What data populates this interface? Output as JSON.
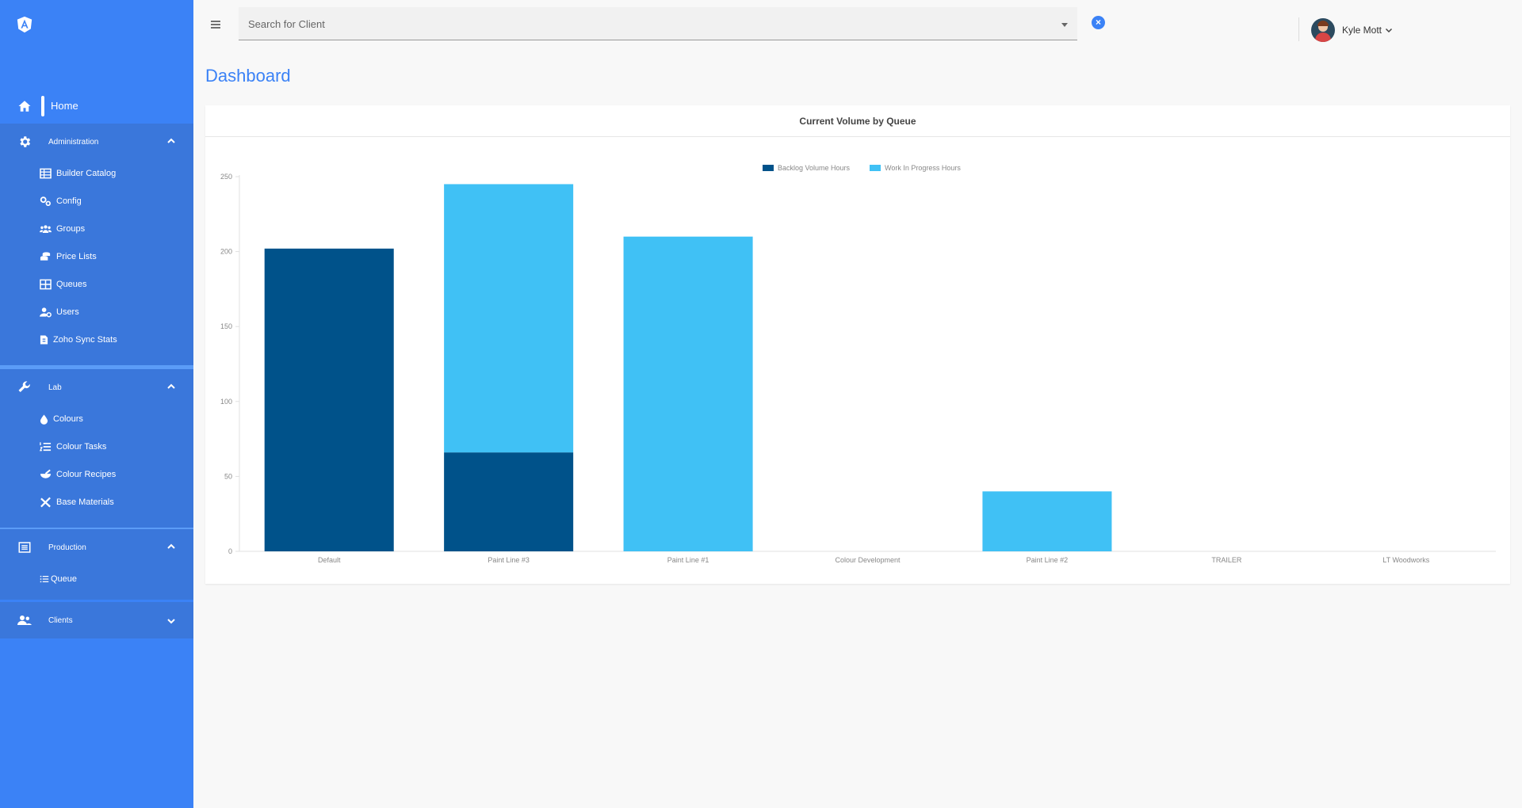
{
  "sidebar": {
    "home": {
      "label": "Home",
      "icon": "home-icon"
    },
    "sections": [
      {
        "label": "Administration",
        "icon": "gear-icon",
        "expanded": true,
        "items": [
          {
            "label": "Builder Catalog",
            "icon": "table-icon"
          },
          {
            "label": "Config",
            "icon": "cogs-icon"
          },
          {
            "label": "Groups",
            "icon": "users-icon"
          },
          {
            "label": "Price Lists",
            "icon": "coins-icon"
          },
          {
            "label": "Queues",
            "icon": "grid-icon"
          },
          {
            "label": "Users",
            "icon": "user-cog-icon"
          },
          {
            "label": "Zoho Sync Stats",
            "icon": "file-invoice-icon"
          }
        ]
      },
      {
        "label": "Lab",
        "icon": "wrench-icon",
        "expanded": true,
        "items": [
          {
            "label": "Colours",
            "icon": "drop-icon"
          },
          {
            "label": "Colour Tasks",
            "icon": "list-ol-icon"
          },
          {
            "label": "Colour Recipes",
            "icon": "mortar-pestle-icon"
          },
          {
            "label": "Base Materials",
            "icon": "tools-icon"
          }
        ]
      },
      {
        "label": "Production",
        "icon": "list-alt-icon",
        "expanded": true,
        "items": [
          {
            "label": "Queue",
            "icon": "list-icon"
          }
        ]
      },
      {
        "label": "Clients",
        "icon": "users-icon",
        "expanded": false,
        "items": []
      }
    ]
  },
  "topbar": {
    "search_placeholder": "Search for Client",
    "clear_label": "×",
    "user_name": "Kyle Mott"
  },
  "page": {
    "title": "Dashboard",
    "card_title": "Current Volume by Queue"
  },
  "colors": {
    "accent": "#3b82f6",
    "backlog": "#00528a",
    "wip": "#40c1f5"
  },
  "chart_data": {
    "type": "bar",
    "stacked": true,
    "categories": [
      "Default",
      "Paint Line #3",
      "Paint Line #1",
      "Colour Development",
      "Paint Line #2",
      "TRAILER",
      "LT Woodworks"
    ],
    "series": [
      {
        "name": "Backlog Volume Hours",
        "color": "#00528a",
        "values": [
          202,
          66,
          0,
          0,
          0,
          0,
          0
        ]
      },
      {
        "name": "Work In Progress Hours",
        "color": "#40c1f5",
        "values": [
          0,
          179,
          210,
          0,
          40,
          0,
          0
        ]
      }
    ],
    "ylim": [
      0,
      250
    ],
    "yticks": [
      0,
      50,
      100,
      150,
      200,
      250
    ],
    "legend": "top-center",
    "grid": false
  }
}
